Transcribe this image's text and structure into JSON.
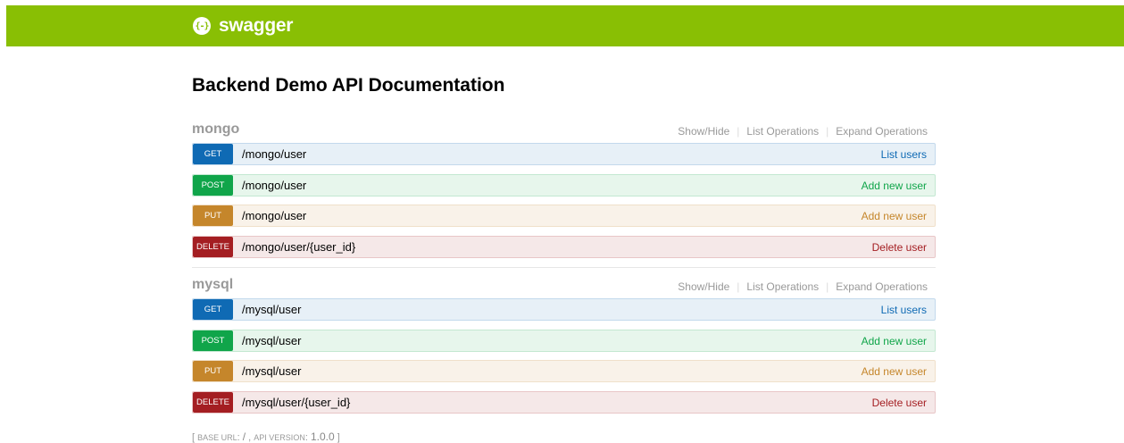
{
  "header": {
    "logo_glyph": "{-}",
    "brand": "swagger"
  },
  "page_title": "Backend Demo API Documentation",
  "section_links": {
    "show_hide": "Show/Hide",
    "list_operations": "List Operations",
    "expand_operations": "Expand Operations"
  },
  "sections": [
    {
      "name": "mongo",
      "operations": [
        {
          "method": "GET",
          "path": "/mongo/user",
          "summary": "List users"
        },
        {
          "method": "POST",
          "path": "/mongo/user",
          "summary": "Add new user"
        },
        {
          "method": "PUT",
          "path": "/mongo/user",
          "summary": "Add new user"
        },
        {
          "method": "DELETE",
          "path": "/mongo/user/{user_id}",
          "summary": "Delete user"
        }
      ]
    },
    {
      "name": "mysql",
      "operations": [
        {
          "method": "GET",
          "path": "/mysql/user",
          "summary": "List users"
        },
        {
          "method": "POST",
          "path": "/mysql/user",
          "summary": "Add new user"
        },
        {
          "method": "PUT",
          "path": "/mysql/user",
          "summary": "Add new user"
        },
        {
          "method": "DELETE",
          "path": "/mysql/user/{user_id}",
          "summary": "Delete user"
        }
      ]
    }
  ],
  "footer": {
    "open_bracket": "[",
    "base_url_label": "Base url",
    "base_url_value": "/",
    "api_version_label": "api version",
    "api_version_value": "1.0.0",
    "close_bracket": "]"
  },
  "colors": {
    "topbar": "#89bf04",
    "get": "#0f6ab4",
    "post": "#10a54a",
    "put": "#c5862b",
    "delete": "#a41e22"
  }
}
